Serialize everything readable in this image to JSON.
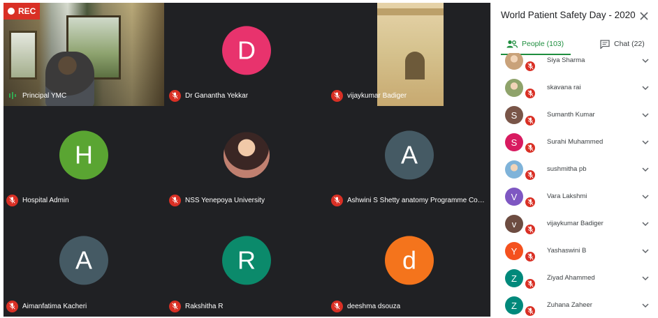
{
  "recording": {
    "label": "REC"
  },
  "tiles": [
    {
      "name": "Principal YMC",
      "mic": "on",
      "kind": "video-principal"
    },
    {
      "name": "Dr Ganantha Yekkar",
      "mic": "off",
      "kind": "avatar",
      "initial": "D",
      "color": "#e8336d"
    },
    {
      "name": "vijaykumar Badiger",
      "mic": "off",
      "kind": "video-vijay"
    },
    {
      "name": "Hospital Admin",
      "mic": "off",
      "kind": "avatar",
      "initial": "H",
      "color": "#5aa532"
    },
    {
      "name": "NSS Yenepoya University",
      "mic": "off",
      "kind": "photo"
    },
    {
      "name": "Ashwini S Shetty anatomy Programme Coordi...",
      "mic": "off",
      "kind": "avatar",
      "initial": "A",
      "color": "#455a64"
    },
    {
      "name": "Aimanfatima Kacheri",
      "mic": "off",
      "kind": "avatar",
      "initial": "A",
      "color": "#455a64"
    },
    {
      "name": "Rakshitha R",
      "mic": "off",
      "kind": "avatar",
      "initial": "R",
      "color": "#0b8a6b"
    },
    {
      "name": "deeshma dsouza",
      "mic": "off",
      "kind": "avatar",
      "initial": "d",
      "color": "#f4741c"
    }
  ],
  "panel": {
    "title": "World Patient Safety Day - 2020",
    "tabs": [
      {
        "label": "People (103)",
        "icon": "people-icon",
        "active": true
      },
      {
        "label": "Chat (22)",
        "icon": "chat-icon",
        "active": false
      }
    ],
    "people": [
      {
        "name": "Siya Sharma",
        "avatar": "photo",
        "color": "#c9a27a"
      },
      {
        "name": "skavana rai",
        "avatar": "photo",
        "color": "#8fa36b"
      },
      {
        "name": "Sumanth Kumar",
        "avatar": "letter",
        "initial": "S",
        "color": "#795548"
      },
      {
        "name": "Surahi Muhammed",
        "avatar": "letter",
        "initial": "S",
        "color": "#d81b60"
      },
      {
        "name": "sushmitha pb",
        "avatar": "photo",
        "color": "#7fb3d9"
      },
      {
        "name": "Vara Lakshmi",
        "avatar": "letter",
        "initial": "V",
        "color": "#7e57c2"
      },
      {
        "name": "vijaykumar Badiger",
        "avatar": "letter",
        "initial": "v",
        "color": "#6d4c41"
      },
      {
        "name": "Yashaswini B",
        "avatar": "letter",
        "initial": "Y",
        "color": "#f4511e"
      },
      {
        "name": "Ziyad Ahammed",
        "avatar": "letter",
        "initial": "Z",
        "color": "#00897b"
      },
      {
        "name": "Zuhana Zaheer",
        "avatar": "letter",
        "initial": "Z",
        "color": "#00897b"
      }
    ]
  }
}
